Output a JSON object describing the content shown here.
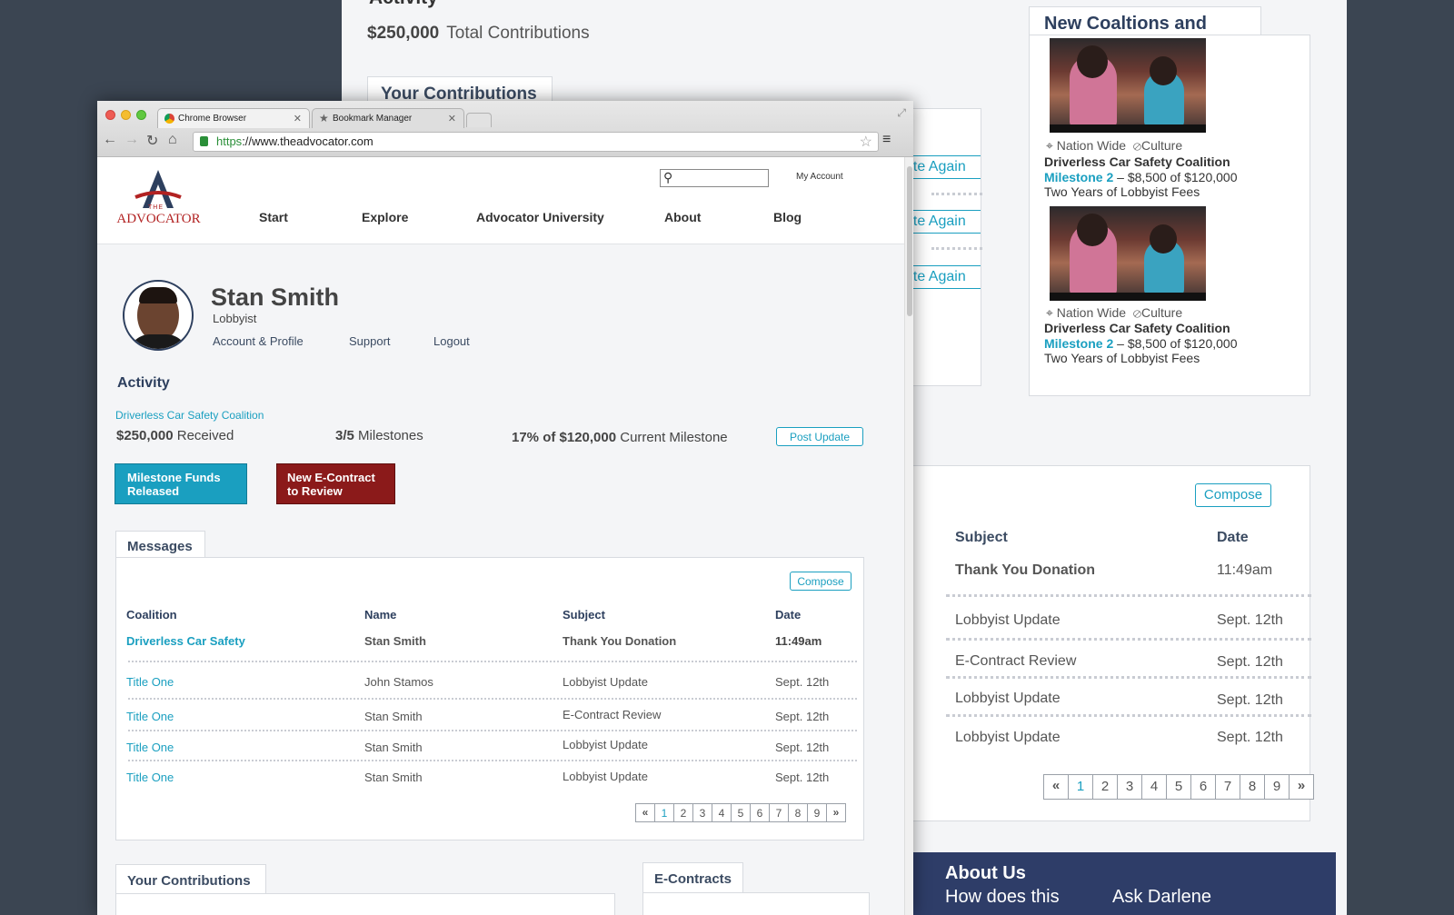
{
  "background_page": {
    "activity_title": "Activity",
    "total_amount": "$250,000",
    "total_label": "Total Contributions",
    "contributions_tab": "Your Contributions",
    "donate_again_label": "ate Again",
    "new_coalitions": {
      "title": "New Coaltions and PACS",
      "cards": [
        {
          "location": "Nation Wide",
          "category": "Culture",
          "title": "Driverless Car Safety Coalition",
          "milestone_label": "Milestone 2",
          "milestone_text": " – $8,500 of $120,000",
          "fees": "Two Years of Lobbyist Fees"
        },
        {
          "location": "Nation Wide",
          "category": "Culture",
          "title": "Driverless Car Safety Coalition",
          "milestone_label": "Milestone 2",
          "milestone_text": " – $8,500 of $120,000",
          "fees": "Two Years of Lobbyist Fees"
        }
      ]
    },
    "messages": {
      "compose_label": "Compose",
      "headers": {
        "subject": "Subject",
        "date": "Date"
      },
      "rows": [
        {
          "subject": "Thank You Donation",
          "date": "11:49am"
        },
        {
          "subject": "Lobbyist Update",
          "date": "Sept. 12th"
        },
        {
          "subject": "E-Contract Review",
          "date": "Sept. 12th"
        },
        {
          "subject": "Lobbyist Update",
          "date": "Sept. 12th"
        },
        {
          "subject": "Lobbyist Update",
          "date": "Sept. 12th"
        }
      ],
      "pages": [
        "1",
        "2",
        "3",
        "4",
        "5",
        "6",
        "7",
        "8",
        "9"
      ],
      "first": "«",
      "last": "»"
    },
    "footer": {
      "about": "About Us",
      "link1": "How does this",
      "link2": "Ask Darlene"
    }
  },
  "browser": {
    "tabs": [
      {
        "label": "Chrome Browser"
      },
      {
        "label": "Bookmark Manager"
      }
    ],
    "url_scheme": "https",
    "url_rest": "://www.theadvocator.com"
  },
  "site": {
    "logo_top": "THE",
    "logo_name": "ADVOCATOR",
    "search_placeholder": "",
    "my_account": "My Account",
    "nav": [
      "Start",
      "Explore",
      "Advocator University",
      "About",
      "Blog"
    ],
    "profile": {
      "name": "Stan Smith",
      "role": "Lobbyist",
      "links": [
        "Account & Profile",
        "Support",
        "Logout"
      ]
    },
    "activity": {
      "title": "Activity",
      "coalition_link": "Driverless Car Safety Coalition",
      "received_amount": "$250,000",
      "received_label": "Received",
      "milestones_count": "3/5",
      "milestones_label": "Milestones",
      "current_amount": "17% of $120,000",
      "current_label": "Current Milestone",
      "post_update": "Post Update",
      "btn_released": "Milestone Funds Released",
      "btn_econtract": "New E-Contract to Review"
    },
    "messages": {
      "tab": "Messages",
      "compose": "Compose",
      "headers": {
        "coalition": "Coalition",
        "name": "Name",
        "subject": "Subject",
        "date": "Date"
      },
      "rows": [
        {
          "coalition": "Driverless Car Safety",
          "name": "Stan Smith",
          "subject": "Thank You Donation",
          "date": "11:49am",
          "bold": true
        },
        {
          "coalition": "Title One",
          "name": "John Stamos",
          "subject": "Lobbyist Update",
          "date": "Sept. 12th",
          "bold": false
        },
        {
          "coalition": "Title One",
          "name": "Stan Smith",
          "subject": "E-Contract Review",
          "date": "Sept. 12th",
          "bold": false
        },
        {
          "coalition": "Title One",
          "name": "Stan Smith",
          "subject": "Lobbyist Update",
          "date": "Sept. 12th",
          "bold": false
        },
        {
          "coalition": "Title One",
          "name": "Stan Smith",
          "subject": "Lobbyist Update",
          "date": "Sept. 12th",
          "bold": false
        }
      ],
      "pages": [
        "1",
        "2",
        "3",
        "4",
        "5",
        "6",
        "7",
        "8",
        "9"
      ],
      "first": "«",
      "last": "»"
    },
    "bottom_tabs": {
      "contributions": "Your Contributions",
      "econtracts": "E-Contracts"
    }
  },
  "colors": {
    "accent": "#1a9fc0",
    "navy": "#2d3f5e",
    "red": "#8b1a1a",
    "footer": "#2e3d68"
  }
}
